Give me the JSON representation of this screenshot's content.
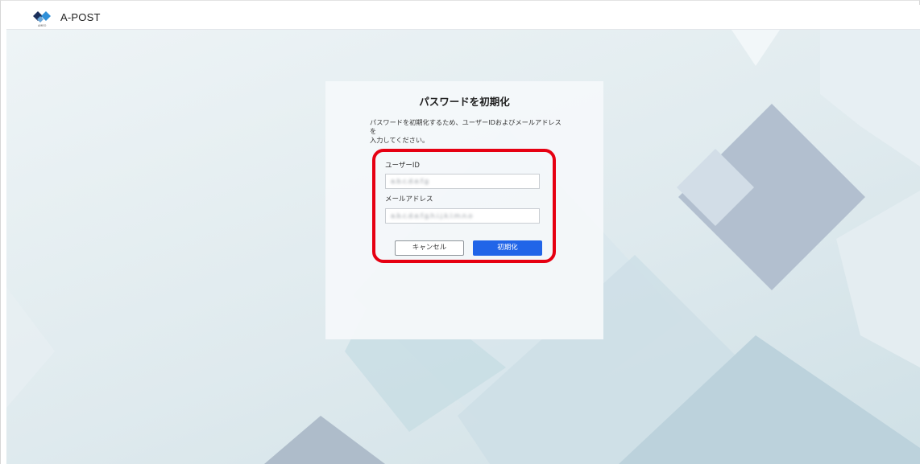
{
  "header": {
    "app_name": "A-POST",
    "logo_icon": "a-post-diamond-logo-icon",
    "logo_sublabel": "AMEO"
  },
  "form": {
    "title": "パスワードを初期化",
    "description_line1": "パスワードを初期化するため、ユーザーIDおよびメールアドレスを",
    "description_line2": "入力してください。",
    "user_id": {
      "label": "ユーザーID",
      "value": "a.b.c.d.e.f.g"
    },
    "email": {
      "label": "メールアドレス",
      "value": "a.b.c.d.e.f.g.h.i.j.k.l.m.n.o"
    },
    "cancel_label": "キャンセル",
    "reset_label": "初期化"
  },
  "colors": {
    "primary_button": "#2165e8",
    "highlight": "#e60012",
    "background": "#dfeaee"
  }
}
